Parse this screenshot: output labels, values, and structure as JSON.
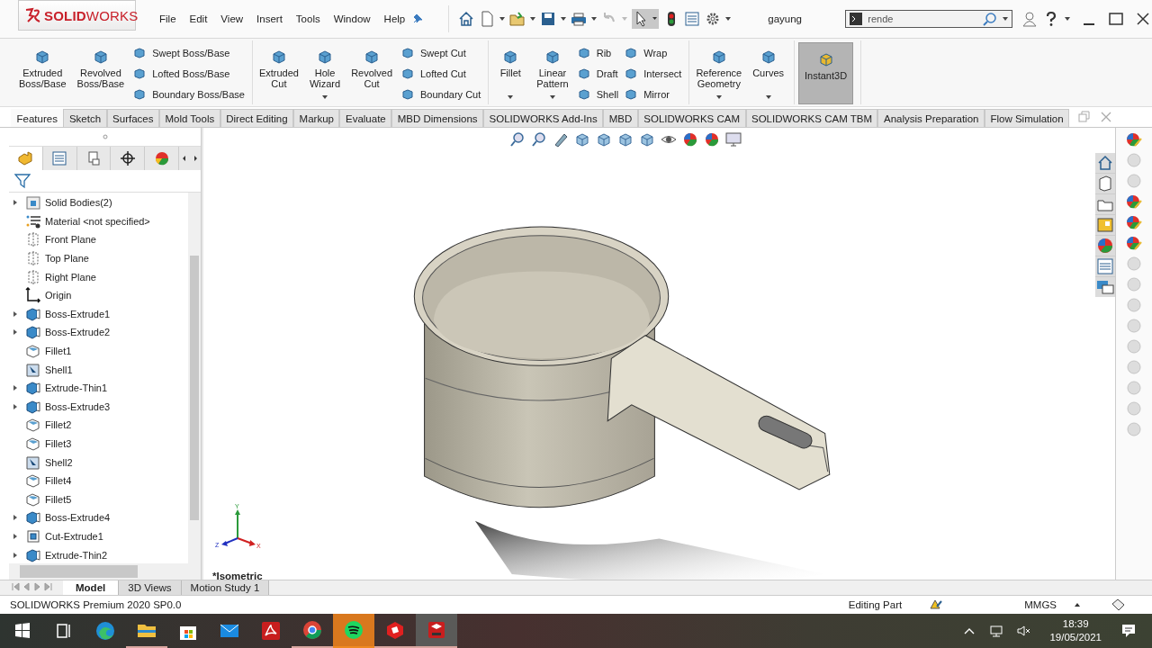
{
  "title_bar": {
    "logo": "**SOLID**WORKS",
    "menus": [
      "File",
      "Edit",
      "View",
      "Insert",
      "Tools",
      "Window",
      "Help"
    ],
    "document": "gayung",
    "search": {
      "value": "rende"
    }
  },
  "ribbon": {
    "groups": [
      {
        "columns": [
          {
            "kind": "large",
            "label": "Extruded Boss/Base",
            "dropdown": false,
            "selected": false
          },
          {
            "kind": "large",
            "label": "Revolved Boss/Base",
            "dropdown": false,
            "selected": false
          },
          {
            "kind": "stack",
            "items": [
              "Swept Boss/Base",
              "Lofted Boss/Base",
              "Boundary Boss/Base"
            ]
          }
        ]
      },
      {
        "columns": [
          {
            "kind": "large",
            "label": "Extruded Cut",
            "dropdown": false,
            "selected": false
          },
          {
            "kind": "large",
            "label": "Hole Wizard",
            "dropdown": true,
            "selected": false
          },
          {
            "kind": "large",
            "label": "Revolved Cut",
            "dropdown": false,
            "selected": false
          },
          {
            "kind": "stack",
            "items": [
              "Swept Cut",
              "Lofted Cut",
              "Boundary Cut"
            ]
          }
        ]
      },
      {
        "columns": [
          {
            "kind": "large",
            "label": "Fillet",
            "dropdown": true,
            "selected": false
          },
          {
            "kind": "large",
            "label": "Linear Pattern",
            "dropdown": true,
            "selected": false
          },
          {
            "kind": "stack",
            "items": [
              "Rib",
              "Draft",
              "Shell"
            ]
          },
          {
            "kind": "stack",
            "items": [
              "Wrap",
              "Intersect",
              "Mirror"
            ]
          }
        ]
      },
      {
        "columns": [
          {
            "kind": "large",
            "label": "Reference Geometry",
            "dropdown": true,
            "selected": false
          },
          {
            "kind": "large",
            "label": "Curves",
            "dropdown": true,
            "selected": false
          }
        ]
      },
      {
        "columns": [
          {
            "kind": "large",
            "label": "Instant3D",
            "dropdown": false,
            "selected": true
          }
        ]
      }
    ]
  },
  "command_tabs": [
    {
      "label": "Features",
      "selected": true
    },
    {
      "label": "Sketch",
      "selected": false
    },
    {
      "label": "Surfaces",
      "selected": false
    },
    {
      "label": "Mold Tools",
      "selected": false
    },
    {
      "label": "Direct Editing",
      "selected": false
    },
    {
      "label": "Markup",
      "selected": false
    },
    {
      "label": "Evaluate",
      "selected": false
    },
    {
      "label": "MBD Dimensions",
      "selected": false
    },
    {
      "label": "SOLIDWORKS Add-Ins",
      "selected": false
    },
    {
      "label": "MBD",
      "selected": false
    },
    {
      "label": "SOLIDWORKS CAM",
      "selected": false
    },
    {
      "label": "SOLIDWORKS CAM TBM",
      "selected": false
    },
    {
      "label": "Analysis Preparation",
      "selected": false
    },
    {
      "label": "Flow Simulation",
      "selected": false
    }
  ],
  "feature_tree": {
    "items": [
      {
        "label": "Solid Bodies(2)",
        "kind": "bodies",
        "expandable": true
      },
      {
        "label": "Material <not specified>",
        "kind": "material",
        "expandable": false
      },
      {
        "label": "Front Plane",
        "kind": "plane",
        "expandable": false
      },
      {
        "label": "Top Plane",
        "kind": "plane",
        "expandable": false
      },
      {
        "label": "Right Plane",
        "kind": "plane",
        "expandable": false
      },
      {
        "label": "Origin",
        "kind": "origin",
        "expandable": false
      },
      {
        "label": "Boss-Extrude1",
        "kind": "extrude",
        "expandable": true
      },
      {
        "label": "Boss-Extrude2",
        "kind": "extrude",
        "expandable": true
      },
      {
        "label": "Fillet1",
        "kind": "fillet",
        "expandable": false
      },
      {
        "label": "Shell1",
        "kind": "shell",
        "expandable": false
      },
      {
        "label": "Extrude-Thin1",
        "kind": "extrude",
        "expandable": true
      },
      {
        "label": "Boss-Extrude3",
        "kind": "extrude",
        "expandable": true
      },
      {
        "label": "Fillet2",
        "kind": "fillet",
        "expandable": false
      },
      {
        "label": "Fillet3",
        "kind": "fillet",
        "expandable": false
      },
      {
        "label": "Shell2",
        "kind": "shell",
        "expandable": false
      },
      {
        "label": "Fillet4",
        "kind": "fillet",
        "expandable": false
      },
      {
        "label": "Fillet5",
        "kind": "fillet",
        "expandable": false
      },
      {
        "label": "Boss-Extrude4",
        "kind": "extrude",
        "expandable": true
      },
      {
        "label": "Cut-Extrude1",
        "kind": "cut",
        "expandable": true
      },
      {
        "label": "Extrude-Thin2",
        "kind": "extrude",
        "expandable": true
      }
    ]
  },
  "panel_tabs": [
    {
      "selected": true
    },
    {
      "selected": false
    },
    {
      "selected": false
    },
    {
      "selected": false
    },
    {
      "selected": false
    }
  ],
  "viewport": {
    "view_name": "*Isometric",
    "triad": [
      "Y",
      "Z",
      "X"
    ]
  },
  "bottom_tabs": [
    {
      "label": "Model",
      "selected": true
    },
    {
      "label": "3D Views",
      "selected": false
    },
    {
      "label": "Motion Study 1",
      "selected": false
    }
  ],
  "status_bar": {
    "product": "SOLIDWORKS Premium 2020 SP0.0",
    "mode": "Editing Part",
    "units": "MMGS"
  },
  "taskbar": {
    "apps": [
      {
        "kind": "edge",
        "running": false,
        "flashing": false,
        "active": false
      },
      {
        "kind": "explorer",
        "running": true,
        "flashing": false,
        "active": false
      },
      {
        "kind": "store",
        "running": false,
        "flashing": false,
        "active": false
      },
      {
        "kind": "mail",
        "running": false,
        "flashing": false,
        "active": false
      },
      {
        "kind": "acrobat",
        "running": false,
        "flashing": false,
        "active": false
      },
      {
        "kind": "chrome",
        "running": true,
        "flashing": false,
        "active": false
      },
      {
        "kind": "spotify",
        "running": true,
        "flashing": true,
        "active": false
      },
      {
        "kind": "sketchup",
        "running": true,
        "flashing": false,
        "active": false
      },
      {
        "kind": "solidworks",
        "running": true,
        "flashing": false,
        "active": true
      }
    ],
    "time": "18:39",
    "date": "19/05/2021"
  }
}
